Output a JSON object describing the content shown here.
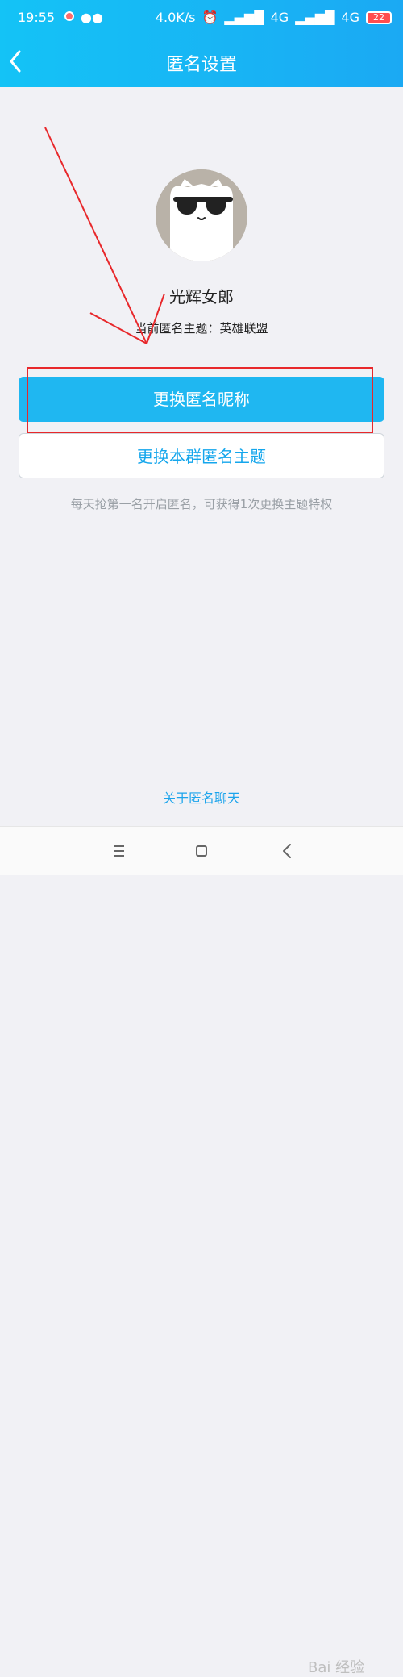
{
  "status_bar": {
    "time": "19:55",
    "network_speed": "4.0K/s",
    "signal1_label": "4G",
    "signal2_label": "4G",
    "battery": "22"
  },
  "nav": {
    "title": "匿名设置"
  },
  "profile": {
    "nickname": "光辉女郎",
    "theme_label": "当前匿名主题：英雄联盟"
  },
  "actions": {
    "change_nickname": "更换匿名昵称",
    "change_theme": "更换本群匿名主题"
  },
  "tip": "每天抢第一名开启匿名，可获得1次更换主题特权",
  "about_link": "关于匿名聊天",
  "bottom_nav": {
    "menu_icon": "menu-icon",
    "home_icon": "home-square-icon",
    "back_icon": "back-chevron-icon"
  },
  "watermark": "Bai 经验",
  "colors": {
    "header_start": "#14c3f6",
    "header_end": "#1ba9f3",
    "primary_button": "#1fb7f1",
    "link": "#1ba4ec",
    "annotation": "#e8282b"
  }
}
